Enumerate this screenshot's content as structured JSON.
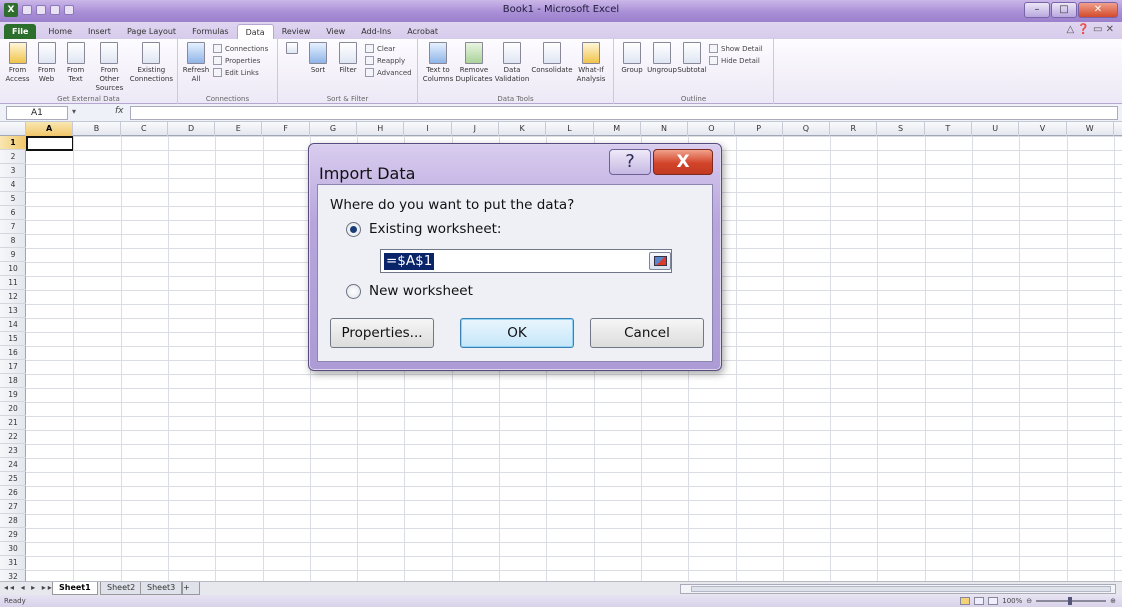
{
  "window": {
    "title": "Book1 - Microsoft Excel"
  },
  "tabs": [
    "File",
    "Home",
    "Insert",
    "Page Layout",
    "Formulas",
    "Data",
    "Review",
    "View",
    "Add-Ins",
    "Acrobat"
  ],
  "active_tab": "Data",
  "ribbon": {
    "get_external_data": {
      "label": "Get External Data",
      "buttons": [
        "From Access",
        "From Web",
        "From Text",
        "From Other Sources",
        "Existing Connections"
      ]
    },
    "connections": {
      "label": "Connections",
      "refresh": "Refresh All",
      "items": [
        "Connections",
        "Properties",
        "Edit Links"
      ]
    },
    "sort_filter": {
      "label": "Sort & Filter",
      "sort": "Sort",
      "filter": "Filter",
      "items": [
        "Clear",
        "Reapply",
        "Advanced"
      ]
    },
    "data_tools": {
      "label": "Data Tools",
      "buttons": [
        "Text to Columns",
        "Remove Duplicates",
        "Data Validation",
        "Consolidate",
        "What-If Analysis"
      ]
    },
    "outline": {
      "label": "Outline",
      "buttons": [
        "Group",
        "Ungroup",
        "Subtotal"
      ],
      "items": [
        "Show Detail",
        "Hide Detail"
      ]
    }
  },
  "formula_bar": {
    "name_box": "A1",
    "fx": "fx"
  },
  "columns": [
    "A",
    "B",
    "C",
    "D",
    "E",
    "F",
    "G",
    "H",
    "I",
    "J",
    "K",
    "L",
    "M",
    "N",
    "O",
    "P",
    "Q",
    "R",
    "S",
    "T",
    "U",
    "V",
    "W"
  ],
  "rows": [
    "1",
    "2",
    "3",
    "4",
    "5",
    "6",
    "7",
    "8",
    "9",
    "10",
    "11",
    "12",
    "13",
    "14",
    "15",
    "16",
    "17",
    "18",
    "19",
    "20",
    "21",
    "22",
    "23",
    "24",
    "25",
    "26",
    "27",
    "28",
    "29",
    "30",
    "31",
    "32"
  ],
  "sheets": [
    "Sheet1",
    "Sheet2",
    "Sheet3"
  ],
  "active_sheet": "Sheet1",
  "status": {
    "text": "Ready",
    "zoom": "100%"
  },
  "dialog": {
    "title": "Import Data",
    "question": "Where do you want to put the data?",
    "option_existing": "Existing worksheet:",
    "option_new": "New worksheet",
    "selected_option": "existing",
    "range_value": "=$A$1",
    "properties_button": "Properties...",
    "ok_button": "OK",
    "cancel_button": "Cancel"
  }
}
